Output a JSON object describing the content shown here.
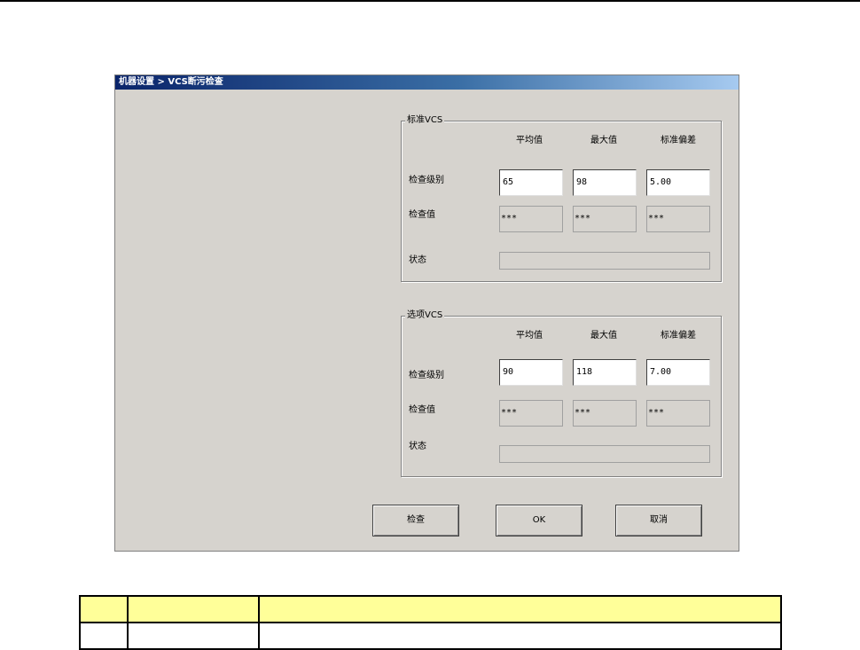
{
  "window": {
    "title": "机器设置 > VCS断污检查"
  },
  "groups": [
    {
      "label": "标准VCS",
      "columns": [
        "平均值",
        "最大值",
        "标准偏差"
      ],
      "row_labels": {
        "level": "检查级别",
        "value": "检查值",
        "status": "状态"
      },
      "level_values": [
        "65",
        "98",
        "5.00"
      ],
      "check_values": [
        "***",
        "***",
        "***"
      ],
      "status_value": ""
    },
    {
      "label": "选项VCS",
      "columns": [
        "平均值",
        "最大值",
        "标准偏差"
      ],
      "row_labels": {
        "level": "检查级别",
        "value": "检查值",
        "status": "状态"
      },
      "level_values": [
        "90",
        "118",
        "7.00"
      ],
      "check_values": [
        "***",
        "***",
        "***"
      ],
      "status_value": ""
    }
  ],
  "buttons": {
    "check": "检查",
    "ok": "OK",
    "cancel": "取消"
  },
  "legend_table": {
    "header": [
      "",
      "",
      ""
    ],
    "rows": [
      [
        "",
        "",
        ""
      ]
    ]
  }
}
